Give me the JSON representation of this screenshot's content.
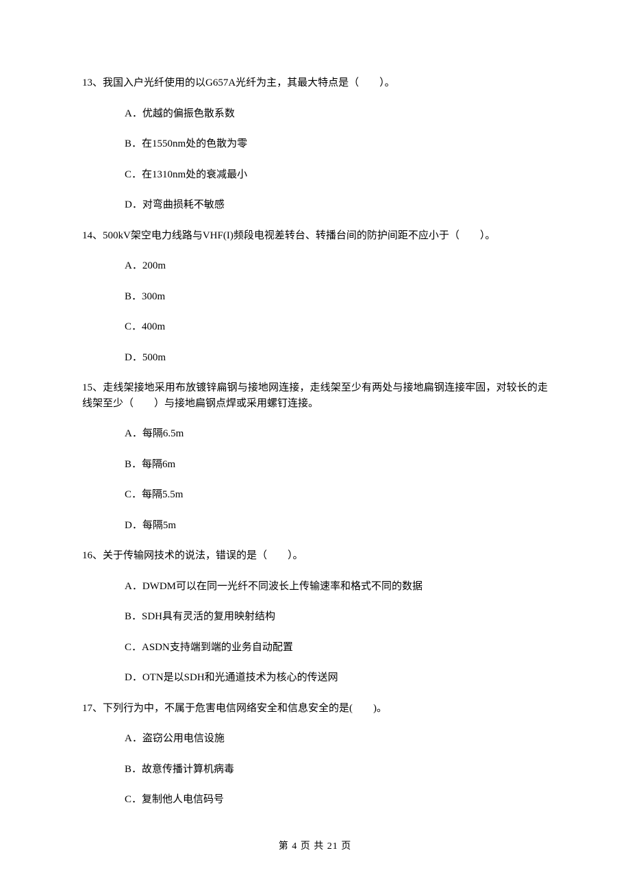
{
  "questions": [
    {
      "stem": "13、我国入户光纤使用的以G657A光纤为主，其最大特点是（　　）。",
      "opts": [
        "A．优越的偏振色散系数",
        "B．在1550nm处的色散为零",
        "C．在1310nm处的衰减最小",
        "D．对弯曲损耗不敏感"
      ]
    },
    {
      "stem": "14、500kV架空电力线路与VHF(I)频段电视差转台、转播台间的防护间距不应小于（　　）。",
      "opts": [
        "A．200m",
        "B．300m",
        "C．400m",
        "D．500m"
      ]
    },
    {
      "stem": "15、走线架接地采用布放镀锌扁钢与接地网连接，走线架至少有两处与接地扁钢连接牢固，对较长的走线架至少（　　）与接地扁钢点焊或采用螺钉连接。",
      "opts": [
        "A．每隔6.5m",
        "B．每隔6m",
        "C．每隔5.5m",
        "D．每隔5m"
      ]
    },
    {
      "stem": "16、关于传输网技术的说法，错误的是（　　）。",
      "opts": [
        "A．DWDM可以在同一光纤不同波长上传输速率和格式不同的数据",
        "B．SDH具有灵活的复用映射结构",
        "C．ASDN支持端到端的业务自动配置",
        "D．OTN是以SDH和光通道技术为核心的传送网"
      ]
    },
    {
      "stem": "17、下列行为中，不属于危害电信网络安全和信息安全的是(　　)。",
      "opts": [
        "A．盗窃公用电信设施",
        "B．故意传播计算机病毒",
        "C．复制他人电信码号"
      ]
    }
  ],
  "footer": "第 4 页 共 21 页"
}
